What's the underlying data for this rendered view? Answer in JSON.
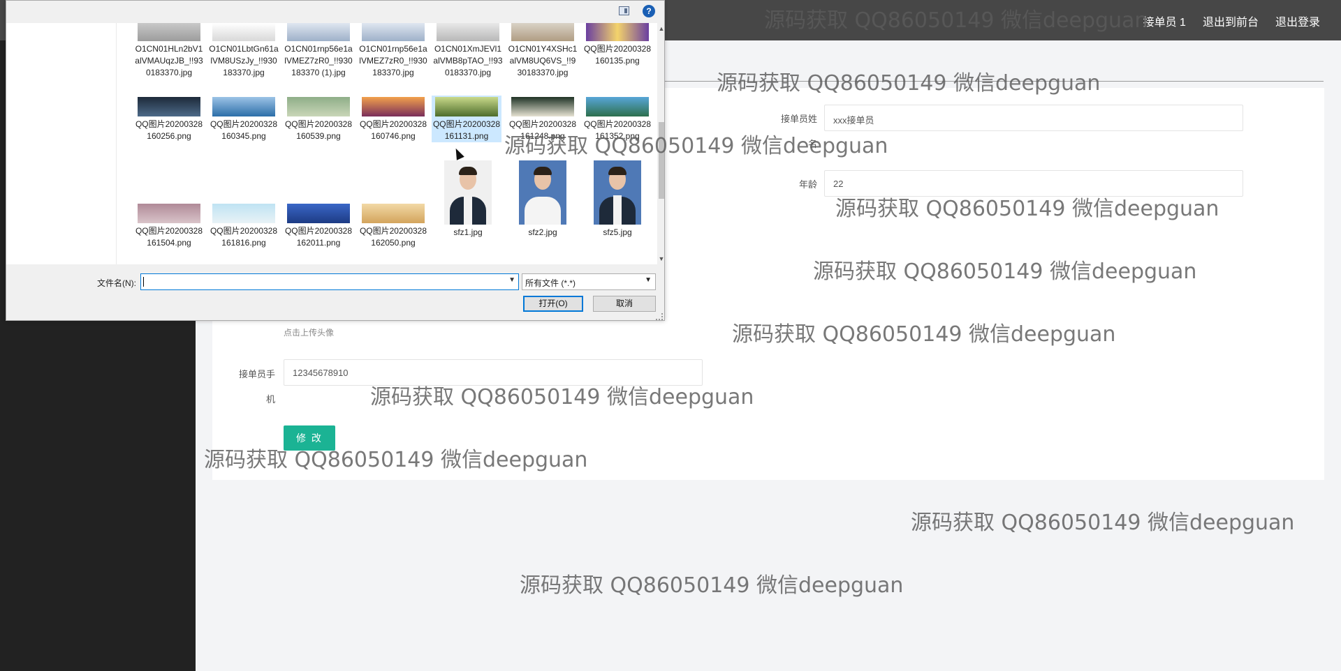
{
  "header": {
    "nav": [
      {
        "label": "接单员 1"
      },
      {
        "label": "退出到前台"
      },
      {
        "label": "退出登录"
      }
    ]
  },
  "form": {
    "name_label": "接单员姓",
    "name_label_wrap": "名",
    "name_value": "xxx接单员",
    "age_label": "年龄",
    "age_value": "22",
    "upload_tip": "点击上传头像",
    "phone_label": "接单员手",
    "phone_label_wrap": "机",
    "phone_value": "12345678910",
    "modify_button": "修 改"
  },
  "watermark": "源码获取 QQ86050149 微信deepguan",
  "dialog": {
    "help_glyph": "?",
    "files": [
      {
        "name": "O1CN01HLn2bV1alVMAUqzJB_!!930183370.jpg"
      },
      {
        "name": "O1CN01LbtGn61alVM8USzJy_!!930183370.jpg"
      },
      {
        "name": "O1CN01rnp56e1alVMEZ7zR0_!!930183370 (1).jpg"
      },
      {
        "name": "O1CN01rnp56e1alVMEZ7zR0_!!930183370.jpg"
      },
      {
        "name": "O1CN01XmJEVl1alVMB8pTAO_!!930183370.jpg"
      },
      {
        "name": "O1CN01Y4XSHc1alVM8UQ6VS_!!930183370.jpg"
      },
      {
        "name": "QQ图片20200328160135.png"
      },
      {
        "name": "QQ图片20200328160256.png"
      },
      {
        "name": "QQ图片20200328160345.png"
      },
      {
        "name": "QQ图片20200328160539.png"
      },
      {
        "name": "QQ图片20200328160746.png"
      },
      {
        "name": "QQ图片20200328161131.png"
      },
      {
        "name": "QQ图片20200328161248.png"
      },
      {
        "name": "QQ图片20200328161352.png"
      },
      {
        "name": "sfz1.jpg"
      },
      {
        "name": "sfz2.jpg"
      },
      {
        "name": "sfz5.jpg"
      },
      {
        "name": "QQ图片20200328161504.png"
      },
      {
        "name": "QQ图片20200328161816.png"
      },
      {
        "name": "QQ图片20200328162011.png"
      },
      {
        "name": "QQ图片20200328162050.png"
      }
    ],
    "filename_label": "文件名(N):",
    "filename_value": "",
    "filter_value": "所有文件 (*.*)",
    "open_button": "打开(O)",
    "cancel_button": "取消"
  }
}
